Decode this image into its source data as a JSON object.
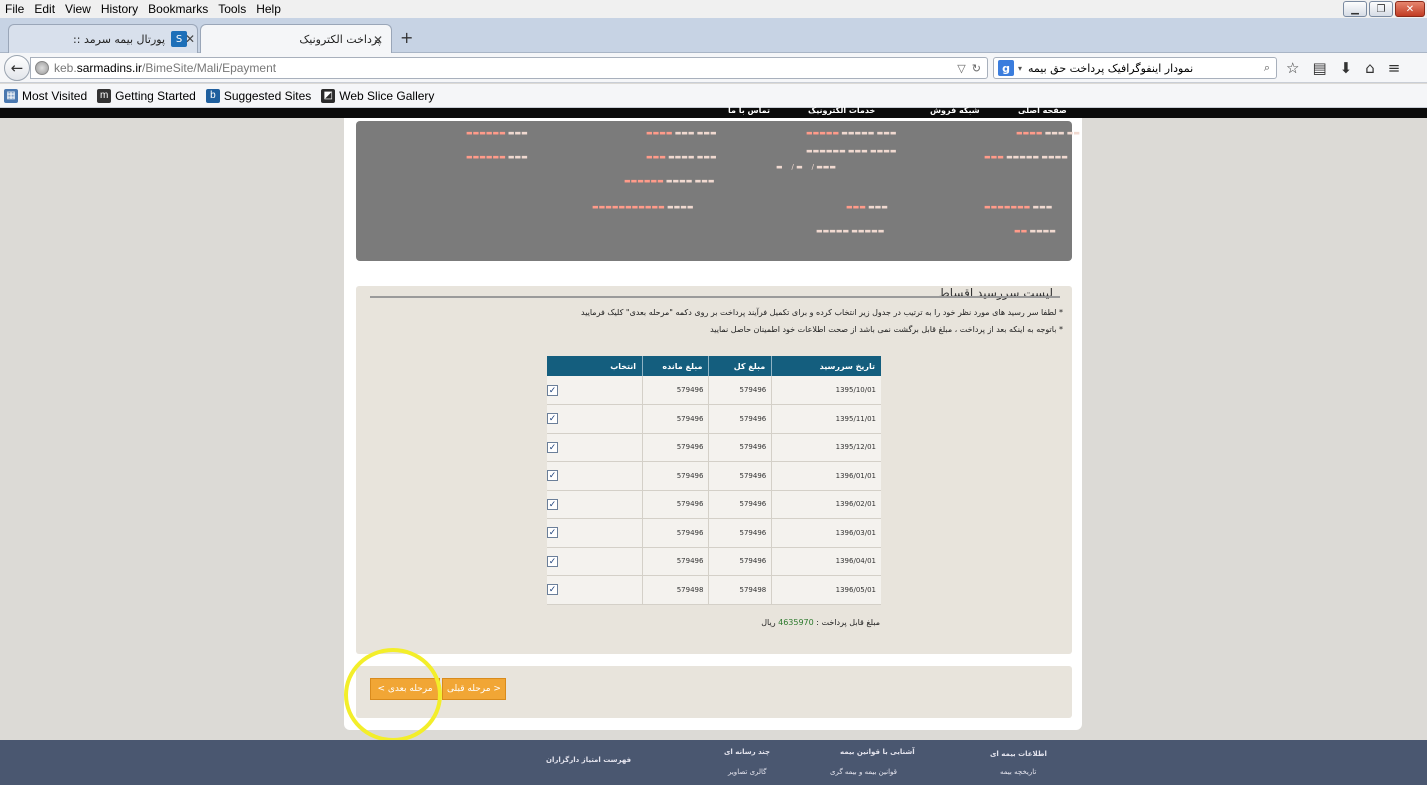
{
  "menu": [
    "File",
    "Edit",
    "View",
    "History",
    "Bookmarks",
    "Tools",
    "Help"
  ],
  "tabs": [
    {
      "title": "پورتال بیمه سرمد ::",
      "active": false
    },
    {
      "title": "پرداخت الکترونیک",
      "active": true
    }
  ],
  "url": {
    "prefix": "keb.",
    "domain": "sarmadins.ir",
    "path": "/BimeSite/Mali/Epayment"
  },
  "search": {
    "value": "نمودار اینفوگرافیک پرداخت حق بیمه",
    "engine_glyph": "g"
  },
  "bookmarks": [
    "Most Visited",
    "Getting Started",
    "Suggested Sites",
    "Web Slice Gallery"
  ],
  "site_nav": [
    "صفحه اصلی",
    "شبکه فروش",
    "خدمات الکترونیک",
    "تماس با ما"
  ],
  "installments": {
    "title": "لیست سررسید اقساط",
    "notes": [
      "* لطفا سر رسید های مورد نظر خود را به ترتیب در جدول زیر انتخاب کرده و برای تکمیل فرآیند پرداخت بر روی دکمه \"مرحله بعدی\" کلیک فرمایید",
      "* باتوجه به اینکه بعد از پرداخت ، مبلغ قابل برگشت نمی باشد از صحت اطلاعات خود اطمینان حاصل نمایید"
    ],
    "columns": [
      "تاریخ سررسید",
      "مبلغ کل",
      "مبلغ مانده",
      "انتخاب"
    ],
    "rows": [
      {
        "date": "1395/10/01",
        "total": "579496",
        "remaining": "579496",
        "checked": true
      },
      {
        "date": "1395/11/01",
        "total": "579496",
        "remaining": "579496",
        "checked": true
      },
      {
        "date": "1395/12/01",
        "total": "579496",
        "remaining": "579496",
        "checked": true
      },
      {
        "date": "1396/01/01",
        "total": "579496",
        "remaining": "579496",
        "checked": true
      },
      {
        "date": "1396/02/01",
        "total": "579496",
        "remaining": "579496",
        "checked": true
      },
      {
        "date": "1396/03/01",
        "total": "579496",
        "remaining": "579496",
        "checked": true
      },
      {
        "date": "1396/04/01",
        "total": "579496",
        "remaining": "579496",
        "checked": true
      },
      {
        "date": "1396/05/01",
        "total": "579498",
        "remaining": "579498",
        "checked": true
      }
    ],
    "total_label": "مبلغ قابل پرداخت :",
    "total_amount": "4635970",
    "total_unit": "ریال"
  },
  "buttons": {
    "next": "مرحله بعدی >",
    "prev": "< مرحله قبلی"
  },
  "footer": {
    "col1_title": "اطلاعات بیمه ای",
    "col1_item": "تاریخچه بیمه",
    "col2_title": "آشنایی با قوانین بیمه",
    "col2_item": "قوانین بیمه و بیمه گری",
    "col3_title": "چند رسانه ای",
    "col3_item": "گالری تصاویر",
    "col4_title": "فهرست امتیاز دارگزاران"
  },
  "colors": {
    "accent_orange": "#f1a635",
    "table_header": "#145e7e",
    "highlight": "#f3ee2a"
  }
}
